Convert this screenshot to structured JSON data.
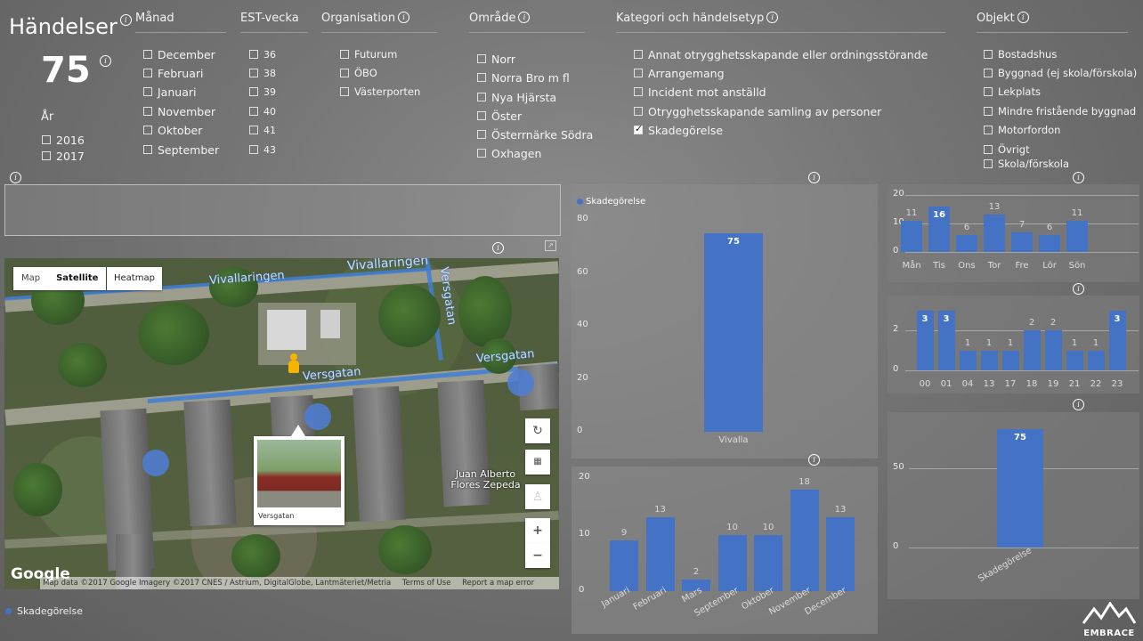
{
  "title": "Händelser",
  "kpi": {
    "value": "75"
  },
  "year": {
    "label": "År",
    "items": [
      {
        "label": "2016",
        "checked": false
      },
      {
        "label": "2017",
        "checked": false
      }
    ]
  },
  "filters": {
    "manad": {
      "header": "Månad",
      "items": [
        "December",
        "Februari",
        "Januari",
        "November",
        "Oktober",
        "September"
      ]
    },
    "vecka": {
      "header": "EST-vecka",
      "items": [
        "36",
        "38",
        "39",
        "40",
        "41",
        "43"
      ]
    },
    "organisation": {
      "header": "Organisation",
      "items": [
        "Futurum",
        "ÖBO",
        "Västerporten"
      ]
    },
    "omrade": {
      "header": "Område",
      "items": [
        "Norr",
        "Norra Bro m fl",
        "Nya Hjärsta",
        "Öster",
        "Österrnärke Södra",
        "Oxhagen"
      ]
    },
    "kategori": {
      "header": "Kategori och händelsetyp",
      "items": [
        {
          "label": "Annat otrygghetsskapande eller ordningsstörande",
          "checked": false
        },
        {
          "label": "Arrangemang",
          "checked": false
        },
        {
          "label": "Incident mot anställd",
          "checked": false
        },
        {
          "label": "Otrygghetsskapande samling av personer",
          "checked": false
        },
        {
          "label": "Skadegörelse",
          "checked": true
        }
      ]
    },
    "objekt": {
      "header": "Objekt",
      "items": [
        "Bostadshus",
        "Byggnad (ej skola/förskola)",
        "Lekplats",
        "Mindre fristående byggnad",
        "Motorfordon",
        "Övrigt",
        "Skola/förskola"
      ]
    }
  },
  "map": {
    "btn_map": "Map",
    "btn_satellite": "Satellite",
    "btn_heatmap": "Heatmap",
    "street1": "Vivallaringen",
    "street2": "Versgatan",
    "street3": "Versgatan",
    "street4": "Versgatan",
    "poi": "Juan Alberto Flores Zepeda",
    "popup_label": "Versgatan",
    "google": "Google",
    "attribution": "Map data ©2017 Google Imagery ©2017 CNES / Astrium, DigitalGlobe, Lantmäteriet/Metria",
    "terms": "Terms of Use",
    "report": "Report a map error",
    "legend": "Skadegörelse"
  },
  "colors": {
    "accent": "#4472c4"
  },
  "chart_data": [
    {
      "type": "bar",
      "legend": "Skadegörelse",
      "categories": [
        "Vivalla"
      ],
      "values": [
        75
      ],
      "ylim": [
        0,
        80
      ],
      "yticks": [
        "80",
        "60",
        "40",
        "20",
        "0"
      ]
    },
    {
      "type": "bar",
      "categories": [
        "Januari",
        "Februari",
        "Mars",
        "September",
        "Oktober",
        "November",
        "December"
      ],
      "values": [
        9,
        13,
        2,
        10,
        10,
        18,
        13
      ],
      "ylim": [
        0,
        20
      ],
      "yticks": [
        "20",
        "10",
        "0"
      ]
    },
    {
      "type": "bar",
      "categories": [
        "Mån",
        "Tis",
        "Ons",
        "Tor",
        "Fre",
        "Lör",
        "Sön"
      ],
      "values": [
        11,
        16,
        6,
        13,
        7,
        6,
        11
      ],
      "ylim": [
        0,
        20
      ],
      "yticks": [
        "20",
        "10",
        "0"
      ]
    },
    {
      "type": "bar",
      "categories": [
        "00",
        "01",
        "04",
        "13",
        "17",
        "18",
        "19",
        "21",
        "22",
        "23"
      ],
      "values": [
        3,
        3,
        1,
        1,
        1,
        2,
        2,
        1,
        1,
        3
      ],
      "yticks": [
        "2",
        "0"
      ]
    },
    {
      "type": "bar",
      "categories": [
        "Skadegörelse"
      ],
      "values": [
        75
      ],
      "yticks": [
        "50",
        "0"
      ]
    }
  ],
  "logo": "EMBRACE"
}
